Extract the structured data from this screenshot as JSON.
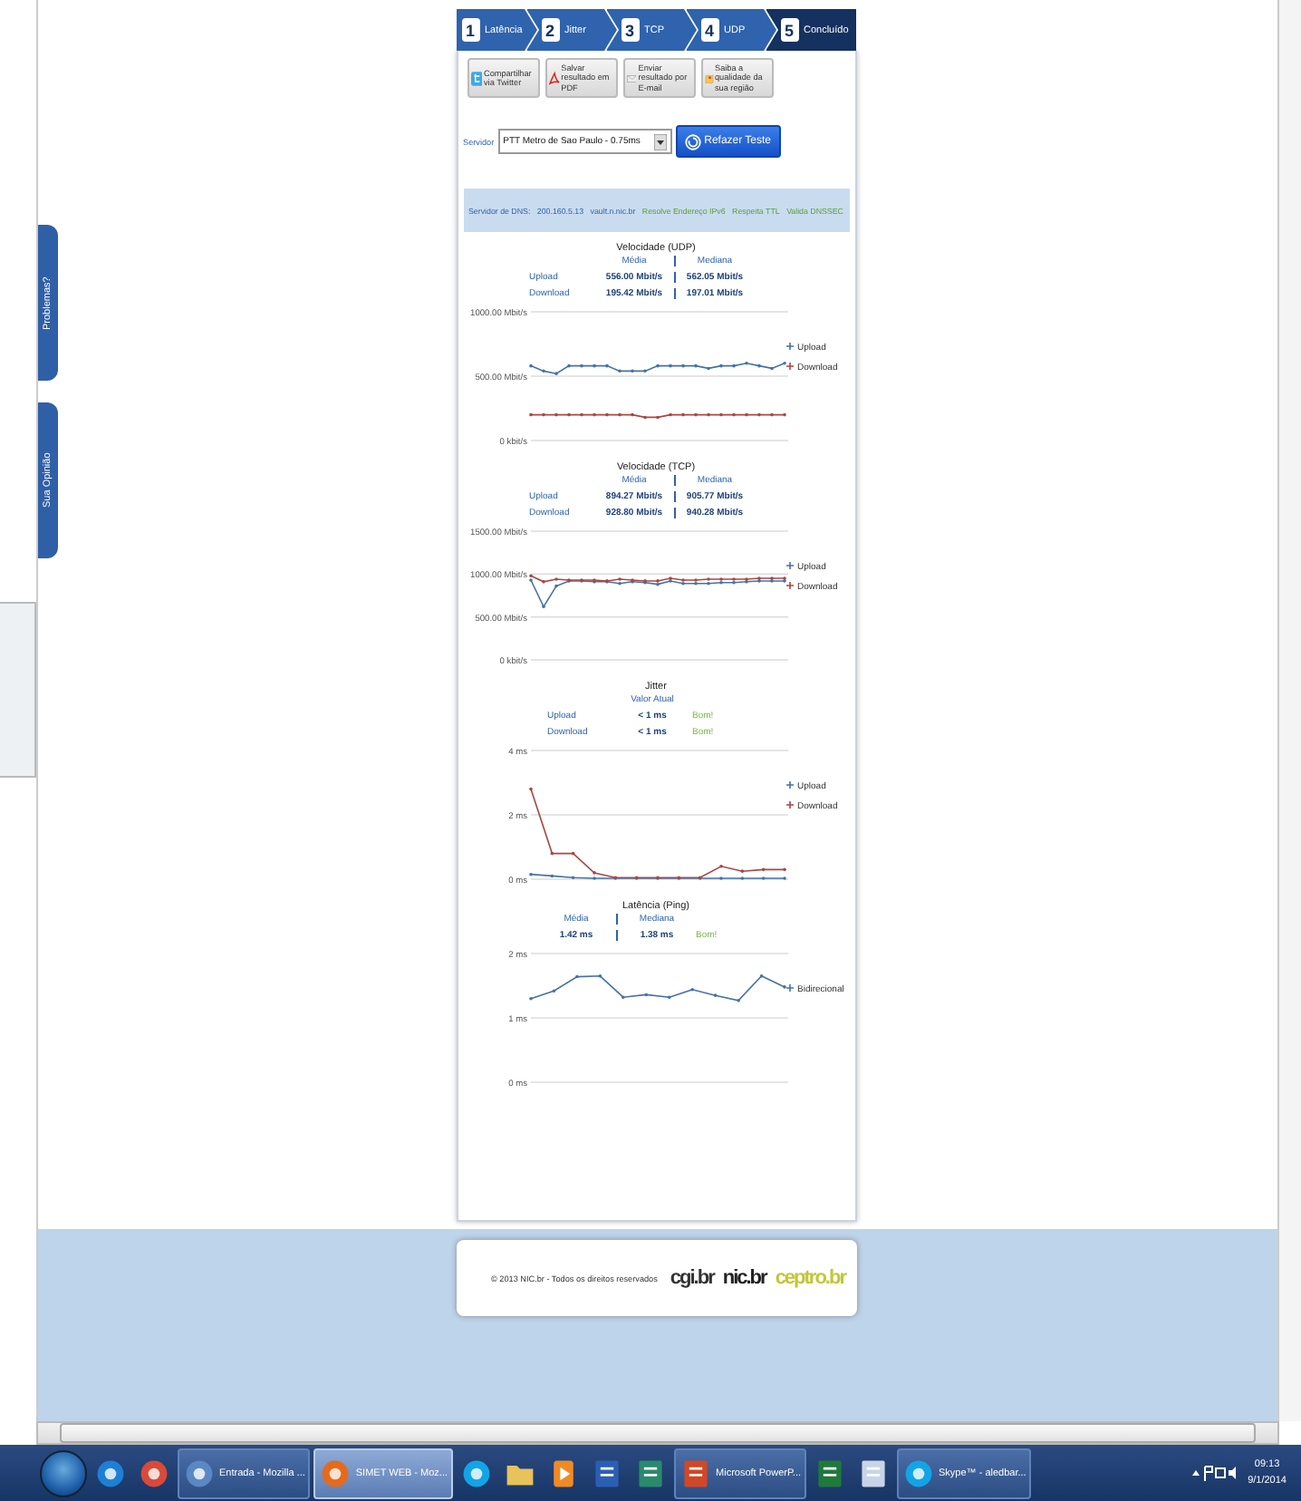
{
  "side_tabs": [
    {
      "label": "Problemas?"
    },
    {
      "label": "Sua Opinião"
    }
  ],
  "steps": [
    {
      "number": "1",
      "label": "Latência",
      "selected": false
    },
    {
      "number": "2",
      "label": "Jitter",
      "selected": false
    },
    {
      "number": "3",
      "label": "TCP",
      "selected": false
    },
    {
      "number": "4",
      "label": "UDP",
      "selected": false
    },
    {
      "number": "5",
      "label": "Concluído",
      "selected": true
    }
  ],
  "actions": [
    {
      "kind": "twitter",
      "label": "Compartilhar via Twitter"
    },
    {
      "kind": "pdf",
      "label": "Salvar resultado em PDF"
    },
    {
      "kind": "email",
      "label": "Enviar resultado por E-mail"
    },
    {
      "kind": "map",
      "label": "Saiba a qualidade da sua região"
    }
  ],
  "server": {
    "label": "Servidor",
    "value": "PTT Metro de Sao Paulo - 0.75ms",
    "button": "Refazer Teste"
  },
  "dns_bar": [
    {
      "kind": "info",
      "text": "Servidor de DNS:"
    },
    {
      "kind": "info",
      "text": "200.160.5.13"
    },
    {
      "kind": "info",
      "text": "vault.n.nic.br"
    },
    {
      "kind": "ok",
      "text": "Resolve Endereço IPv6"
    },
    {
      "kind": "ok",
      "text": "Respeita TTL"
    },
    {
      "kind": "ok",
      "text": "Valida DNSSEC"
    }
  ],
  "charts": [
    {
      "title": "Velocidade (UDP)",
      "columns": [
        "Média",
        "Mediana"
      ],
      "rows": [
        {
          "label": "Upload",
          "values": [
            "556.00 Mbit/s",
            "562.05 Mbit/s"
          ]
        },
        {
          "label": "Download",
          "values": [
            "195.42 Mbit/s",
            "197.01 Mbit/s"
          ]
        }
      ],
      "chart_data": {
        "type": "line",
        "ylim": [
          0,
          1000
        ],
        "yticks": [
          {
            "value": 0,
            "label": "0 kbit/s"
          },
          {
            "value": 500,
            "label": "500.00 Mbit/s"
          },
          {
            "value": 1000,
            "label": "1000.00 Mbit/s"
          }
        ],
        "series": [
          {
            "name": "Upload",
            "color": "#4572a7",
            "values": [
              580,
              540,
              520,
              580,
              580,
              580,
              580,
              540,
              540,
              540,
              580,
              580,
              580,
              580,
              560,
              580,
              580,
              600,
              580,
              560,
              600
            ]
          },
          {
            "name": "Download",
            "color": "#aa4643",
            "values": [
              200,
              200,
              200,
              200,
              200,
              200,
              200,
              200,
              200,
              180,
              180,
              200,
              200,
              200,
              200,
              200,
              200,
              200,
              200,
              200,
              200
            ]
          }
        ],
        "legend": "right"
      }
    },
    {
      "title": "Velocidade (TCP)",
      "columns": [
        "Média",
        "Mediana"
      ],
      "rows": [
        {
          "label": "Upload",
          "values": [
            "894.27 Mbit/s",
            "905.77 Mbit/s"
          ]
        },
        {
          "label": "Download",
          "values": [
            "928.80 Mbit/s",
            "940.28 Mbit/s"
          ]
        }
      ],
      "chart_data": {
        "type": "line",
        "ylim": [
          0,
          1500
        ],
        "yticks": [
          {
            "value": 0,
            "label": "0 kbit/s"
          },
          {
            "value": 500,
            "label": "500.00 Mbit/s"
          },
          {
            "value": 1000,
            "label": "1000.00 Mbit/s"
          },
          {
            "value": 1500,
            "label": "1500.00 Mbit/s"
          }
        ],
        "series": [
          {
            "name": "Upload",
            "color": "#4572a7",
            "values": [
              930,
              620,
              860,
              920,
              920,
              910,
              910,
              890,
              910,
              900,
              880,
              920,
              890,
              890,
              890,
              900,
              900,
              910,
              920,
              920,
              920
            ]
          },
          {
            "name": "Download",
            "color": "#aa4643",
            "values": [
              980,
              910,
              940,
              930,
              930,
              930,
              920,
              940,
              930,
              920,
              920,
              950,
              930,
              930,
              940,
              940,
              940,
              940,
              950,
              950,
              950
            ]
          }
        ],
        "legend": "right"
      }
    },
    {
      "title": "Jitter",
      "columns": [
        "Valor Atual"
      ],
      "rows": [
        {
          "label": "Upload",
          "values": [
            "< 1 ms"
          ],
          "status": "Bom!"
        },
        {
          "label": "Download",
          "values": [
            "< 1 ms"
          ],
          "status": "Bom!"
        }
      ],
      "chart_data": {
        "type": "line",
        "ylim": [
          0,
          4
        ],
        "yticks": [
          {
            "value": 0,
            "label": "0 ms"
          },
          {
            "value": 2,
            "label": "2 ms"
          },
          {
            "value": 4,
            "label": "4 ms"
          }
        ],
        "series": [
          {
            "name": "Upload",
            "color": "#4572a7",
            "values": [
              0.15,
              0.1,
              0.05,
              0.03,
              0.03,
              0.03,
              0.03,
              0.03,
              0.03,
              0.03,
              0.03,
              0.03,
              0.03
            ]
          },
          {
            "name": "Download",
            "color": "#aa4643",
            "values": [
              2.8,
              0.8,
              0.8,
              0.2,
              0.05,
              0.05,
              0.05,
              0.05,
              0.05,
              0.4,
              0.25,
              0.3,
              0.3
            ]
          }
        ],
        "legend": "right"
      }
    },
    {
      "title": "Latência (Ping)",
      "columns": [
        "Média",
        "Mediana"
      ],
      "rows": [
        {
          "values": [
            "1.42 ms",
            "1.38 ms"
          ],
          "status": "Bom!"
        }
      ],
      "chart_data": {
        "type": "line",
        "ylim": [
          0,
          2
        ],
        "yticks": [
          {
            "value": 0,
            "label": "0 ms"
          },
          {
            "value": 1,
            "label": "1 ms"
          },
          {
            "value": 2,
            "label": "2 ms"
          }
        ],
        "series": [
          {
            "name": "Bidirecional",
            "color": "#4572a7",
            "values": [
              1.3,
              1.42,
              1.64,
              1.65,
              1.32,
              1.36,
              1.32,
              1.44,
              1.35,
              1.27,
              1.65,
              1.48
            ]
          }
        ],
        "legend": "right"
      }
    }
  ],
  "footer": {
    "copyright": "© 2013 NIC.br - Todos os direitos reservados",
    "logos": [
      "cgi.br",
      "nic.br",
      "ceptro.br"
    ]
  },
  "taskbar": {
    "windows": [
      {
        "label": "Entrada - Mozilla ...",
        "active": false
      },
      {
        "label": "SIMET WEB - Moz...",
        "active": true
      },
      {
        "label": "Microsoft PowerP...",
        "active": false
      },
      {
        "label": "Skype™ - aledbar...",
        "active": false
      }
    ],
    "time": "09:13",
    "date": "9/1/2014"
  }
}
